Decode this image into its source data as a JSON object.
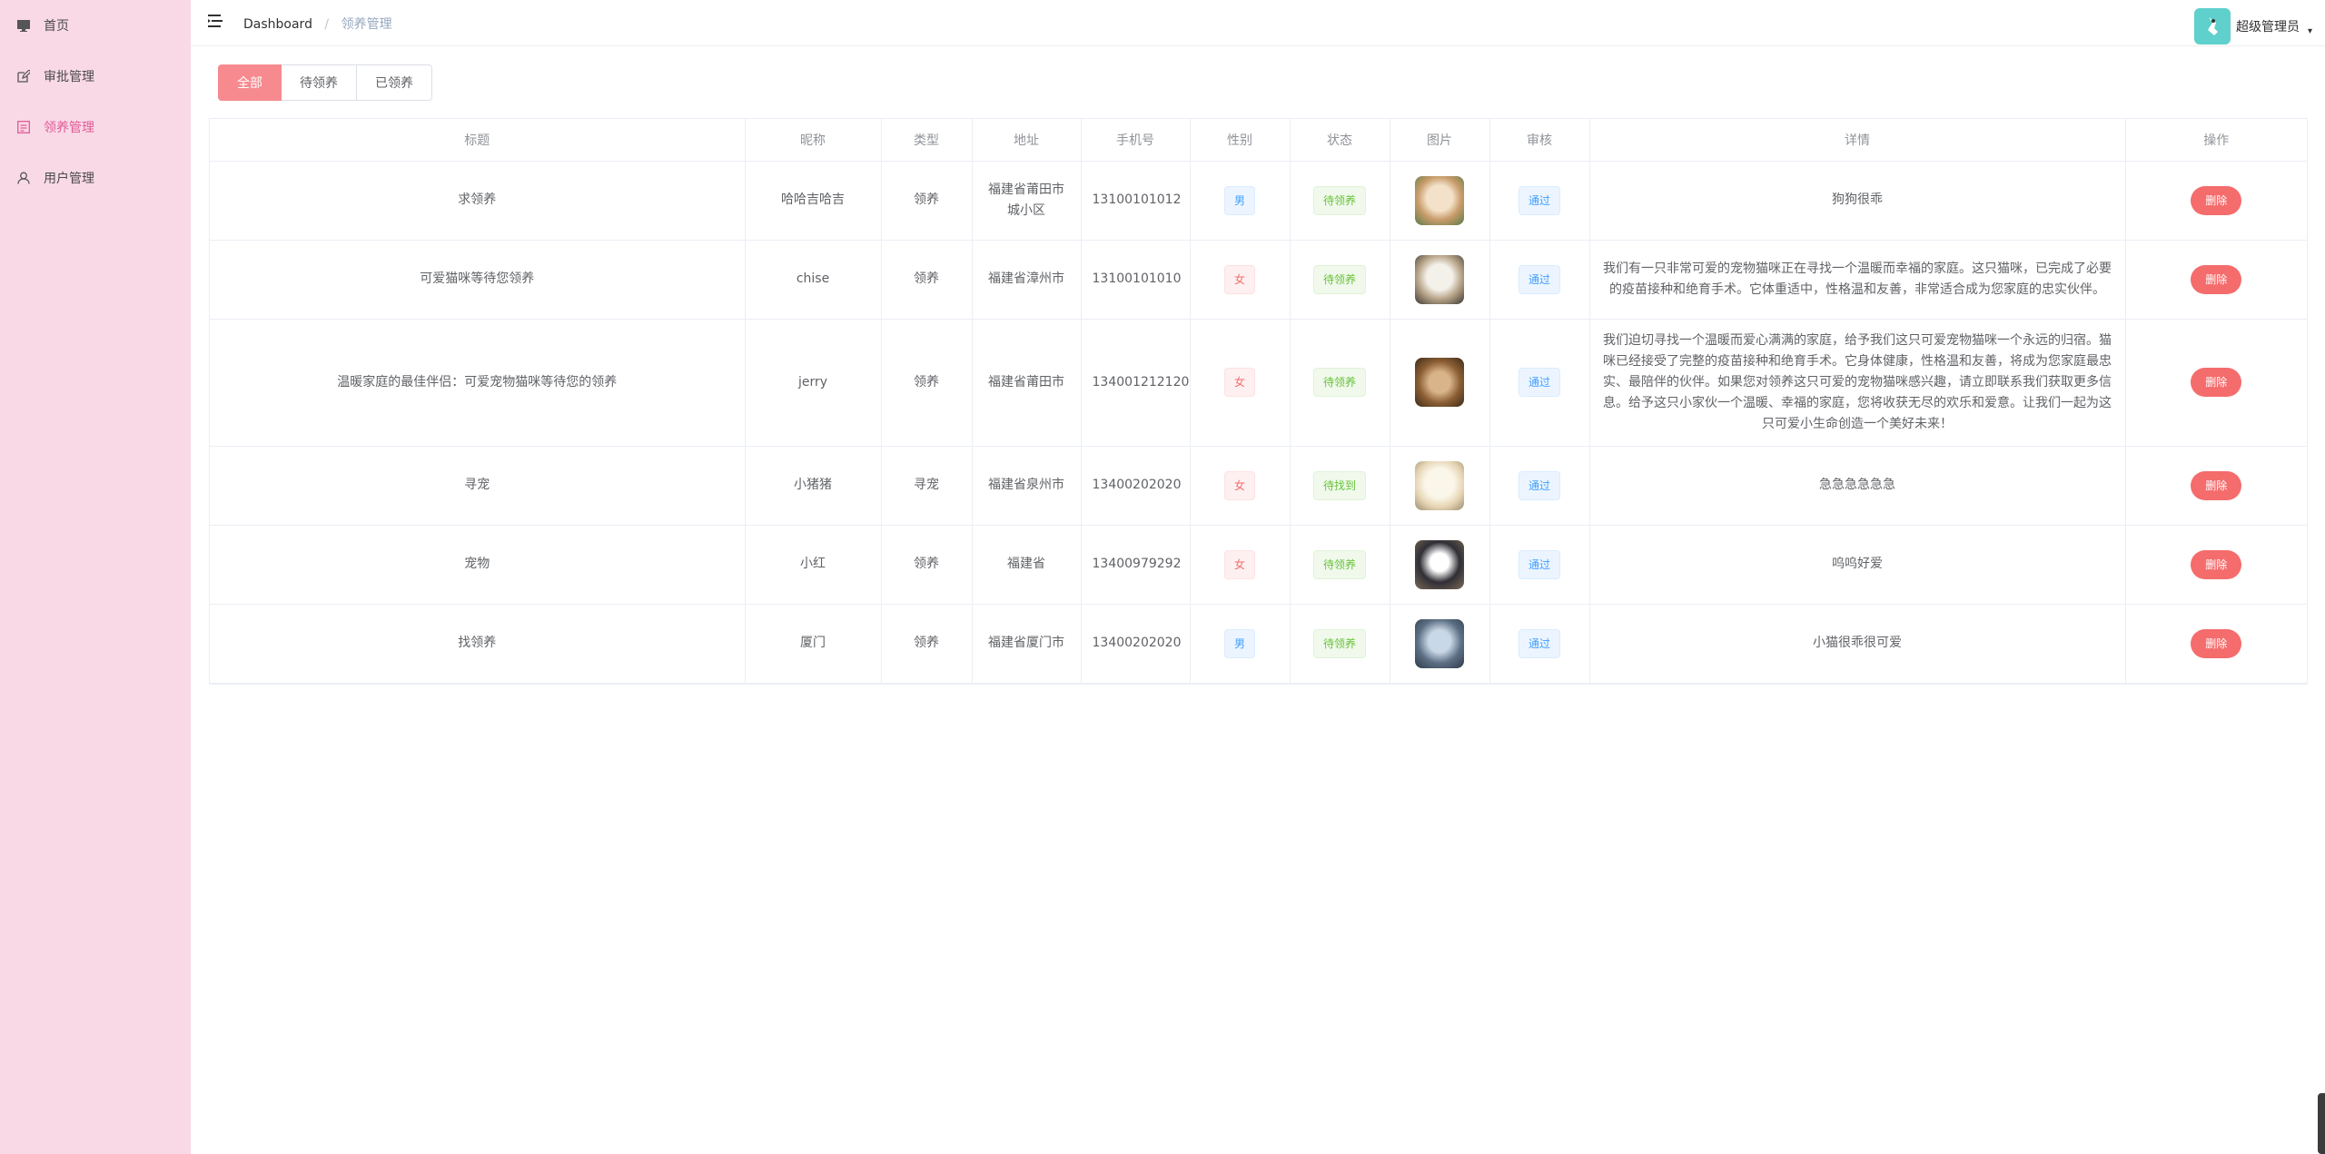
{
  "sidebar": {
    "items": [
      {
        "label": "首页",
        "icon": "monitor-icon"
      },
      {
        "label": "审批管理",
        "icon": "edit-icon"
      },
      {
        "label": "领养管理",
        "icon": "list-icon"
      },
      {
        "label": "用户管理",
        "icon": "user-icon"
      }
    ]
  },
  "header": {
    "breadcrumb_home": "Dashboard",
    "breadcrumb_separator": "/",
    "breadcrumb_current": "领养管理",
    "user_name": "超级管理员",
    "caret": "▾"
  },
  "tabs": [
    "全部",
    "待领养",
    "已领养"
  ],
  "table": {
    "columns": [
      "标题",
      "昵称",
      "类型",
      "地址",
      "手机号",
      "性别",
      "状态",
      "图片",
      "审核",
      "详情",
      "操作"
    ],
    "rows": [
      {
        "title": "求领养",
        "nickname": "哈哈吉哈吉",
        "type": "领养",
        "address": "福建省莆田市城小区",
        "phone": "13100101012",
        "gender": "男",
        "status": "待领养",
        "audit": "通过",
        "detail": "狗狗很乖",
        "action": "删除"
      },
      {
        "title": "可爱猫咪等待您领养",
        "nickname": "chise",
        "type": "领养",
        "address": "福建省漳州市",
        "phone": "13100101010",
        "gender": "女",
        "status": "待领养",
        "audit": "通过",
        "detail": "我们有一只非常可爱的宠物猫咪正在寻找一个温暖而幸福的家庭。这只猫咪，已完成了必要的疫苗接种和绝育手术。它体重适中，性格温和友善，非常适合成为您家庭的忠实伙伴。",
        "action": "删除"
      },
      {
        "title": "温暖家庭的最佳伴侣：可爱宠物猫咪等待您的领养",
        "nickname": "jerry",
        "type": "领养",
        "address": "福建省莆田市",
        "phone": "134001212120",
        "gender": "女",
        "status": "待领养",
        "audit": "通过",
        "detail": "我们迫切寻找一个温暖而爱心满满的家庭，给予我们这只可爱宠物猫咪一个永远的归宿。猫咪已经接受了完整的疫苗接种和绝育手术。它身体健康，性格温和友善，将成为您家庭最忠实、最陪伴的伙伴。如果您对领养这只可爱的宠物猫咪感兴趣，请立即联系我们获取更多信息。给予这只小家伙一个温暖、幸福的家庭，您将收获无尽的欢乐和爱意。让我们一起为这只可爱小生命创造一个美好未来！",
        "action": "删除"
      },
      {
        "title": "寻宠",
        "nickname": "小猪猪",
        "type": "寻宠",
        "address": "福建省泉州市",
        "phone": "13400202020",
        "gender": "女",
        "status": "待找到",
        "audit": "通过",
        "detail": "急急急急急急",
        "action": "删除"
      },
      {
        "title": "宠物",
        "nickname": "小红",
        "type": "领养",
        "address": "福建省",
        "phone": "13400979292",
        "gender": "女",
        "status": "待领养",
        "audit": "通过",
        "detail": "呜呜好爱",
        "action": "删除"
      },
      {
        "title": "找领养",
        "nickname": "厦门",
        "type": "领养",
        "address": "福建省厦门市",
        "phone": "13400202020",
        "gender": "男",
        "status": "待领养",
        "audit": "通过",
        "detail": "小猫很乖很可爱",
        "action": "删除"
      }
    ]
  },
  "colors": {
    "sidebar_bg": "#f9d9e6",
    "active_menu": "#e15b97",
    "active_tab": "#f78a8f",
    "delete_button": "#f56c6c"
  }
}
